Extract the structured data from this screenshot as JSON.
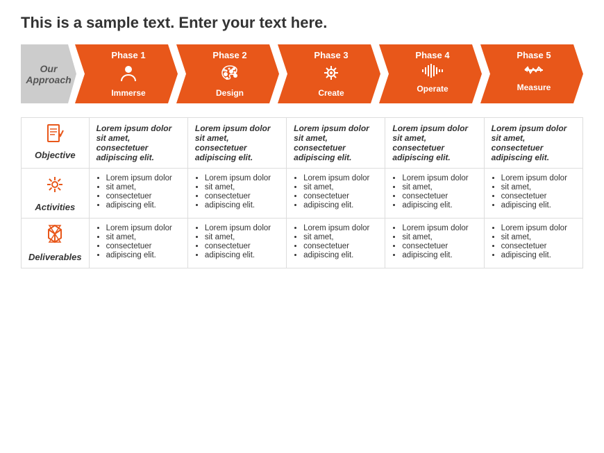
{
  "title": "This is a sample text. Enter your text here.",
  "approach_label": "Our\nApproach",
  "phases": [
    {
      "label": "Phase 1",
      "icon": "👤",
      "name": "Immerse"
    },
    {
      "label": "Phase 2",
      "icon": "🎨",
      "name": "Design"
    },
    {
      "label": "Phase 3",
      "icon": "⚙️",
      "name": "Create"
    },
    {
      "label": "Phase 4",
      "icon": "📊",
      "name": "Operate"
    },
    {
      "label": "Phase 5",
      "icon": "↔",
      "name": "Measure"
    }
  ],
  "rows": [
    {
      "icon": "📋",
      "label": "Objective",
      "type": "objective",
      "cells": [
        "Lorem ipsum dolor sit amet, consectetuer adipiscing elit.",
        "Lorem ipsum dolor sit amet, consectetuer adipiscing elit.",
        "Lorem ipsum dolor sit amet, consectetuer adipiscing elit.",
        "Lorem ipsum dolor sit amet, consectetuer adipiscing elit.",
        "Lorem ipsum dolor sit amet, consectetuer adipiscing elit."
      ]
    },
    {
      "icon": "✳",
      "label": "Activities",
      "type": "bullets",
      "cells": [
        [
          "Lorem ipsum dolor",
          "sit amet,",
          "consectetuer",
          "adipiscing elit."
        ],
        [
          "Lorem ipsum dolor",
          "sit amet,",
          "consectetuer",
          "adipiscing elit."
        ],
        [
          "Lorem ipsum dolor",
          "sit amet,",
          "consectetuer",
          "adipiscing elit."
        ],
        [
          "Lorem ipsum dolor",
          "sit amet,",
          "consectetuer",
          "adipiscing elit."
        ],
        [
          "Lorem ipsum dolor",
          "sit amet,",
          "consectetuer",
          "adipiscing elit."
        ]
      ]
    },
    {
      "icon": "⏳",
      "label": "Deliverables",
      "type": "bullets",
      "cells": [
        [
          "Lorem ipsum dolor",
          "sit amet,",
          "consectetuer",
          "adipiscing elit."
        ],
        [
          "Lorem ipsum dolor",
          "sit amet,",
          "consectetuer",
          "adipiscing elit."
        ],
        [
          "Lorem ipsum dolor",
          "sit amet,",
          "consectetuer",
          "adipiscing elit."
        ],
        [
          "Lorem ipsum dolor",
          "sit amet,",
          "consectetuer",
          "adipiscing elit."
        ],
        [
          "Lorem ipsum dolor",
          "sit amet,",
          "consectetuer",
          "adipiscing elit."
        ]
      ]
    }
  ],
  "colors": {
    "orange": "#e8571a",
    "gray": "#ccc",
    "text": "#333"
  }
}
